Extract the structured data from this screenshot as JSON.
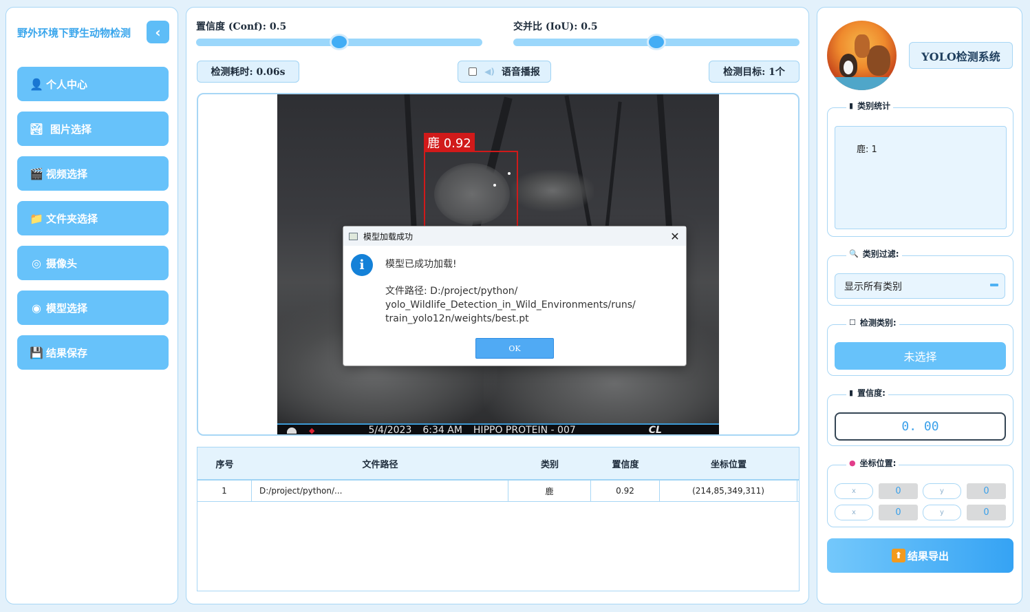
{
  "sidebar": {
    "app_title": "野外环境下野生动物检测",
    "collapse_icon": "‹",
    "items": [
      {
        "label": "个人中心",
        "icon": "user-icon",
        "glyph": "👤"
      },
      {
        "label": "图片选择",
        "icon": "image-icon",
        "glyph": "🏞"
      },
      {
        "label": "视频选择",
        "icon": "clapper-icon",
        "glyph": "🎬"
      },
      {
        "label": "文件夹选择",
        "icon": "folder-icon",
        "glyph": "📁"
      },
      {
        "label": "摄像头",
        "icon": "camera-icon",
        "glyph": "◎"
      },
      {
        "label": "模型选择",
        "icon": "model-icon",
        "glyph": "◉"
      },
      {
        "label": "结果保存",
        "icon": "save-icon",
        "glyph": "💾"
      }
    ]
  },
  "controls": {
    "conf_label": "置信度 (Conf): 0.5",
    "conf_value": 0.5,
    "iou_label": "交并比 (IoU): 0.5",
    "iou_value": 0.5,
    "time_label": "检测耗时: 0.06s",
    "voice_label": "语音播报",
    "voice_checked": false,
    "target_label": "检测目标: 1个"
  },
  "detection": {
    "label": "鹿 0.92",
    "footer": {
      "date": "5/4/2023",
      "time": "6:34 AM",
      "camera": "HIPPO PROTEIN - 007",
      "brand": "CL"
    }
  },
  "dialog": {
    "title": "模型加载成功",
    "close": "✕",
    "icon": "i",
    "message": "模型已成功加载!",
    "path_lines": [
      "文件路径: D:/project/python/",
      "yolo_Wildlife_Detection_in_Wild_Environments/runs/",
      "train_yolo12n/weights/best.pt"
    ],
    "ok_label": "OK"
  },
  "table": {
    "headers": [
      "序号",
      "文件路径",
      "类别",
      "置信度",
      "坐标位置"
    ],
    "rows": [
      [
        "1",
        "D:/project/python/...",
        "鹿",
        "0.92",
        "(214,85,349,311)"
      ]
    ]
  },
  "right": {
    "system_title": "YOLO检测系统",
    "stats_title": "类别统计",
    "stats_text": "鹿: 1",
    "filter_title": "类别过滤:",
    "filter_value": "显示所有类别",
    "class_title": "检测类别:",
    "class_value": "未选择",
    "conf_title": "置信度:",
    "conf_value": "0. 00",
    "coord_title": "坐标位置:",
    "coords": [
      {
        "label": "x",
        "value": "0"
      },
      {
        "label": "y",
        "value": "0"
      },
      {
        "label": "x",
        "value": "0"
      },
      {
        "label": "y",
        "value": "0"
      }
    ],
    "export_label": "结果导出"
  },
  "colors": {
    "accent": "#67c2fa",
    "border": "#a7d6f5",
    "detection_red": "#d11a1a"
  }
}
